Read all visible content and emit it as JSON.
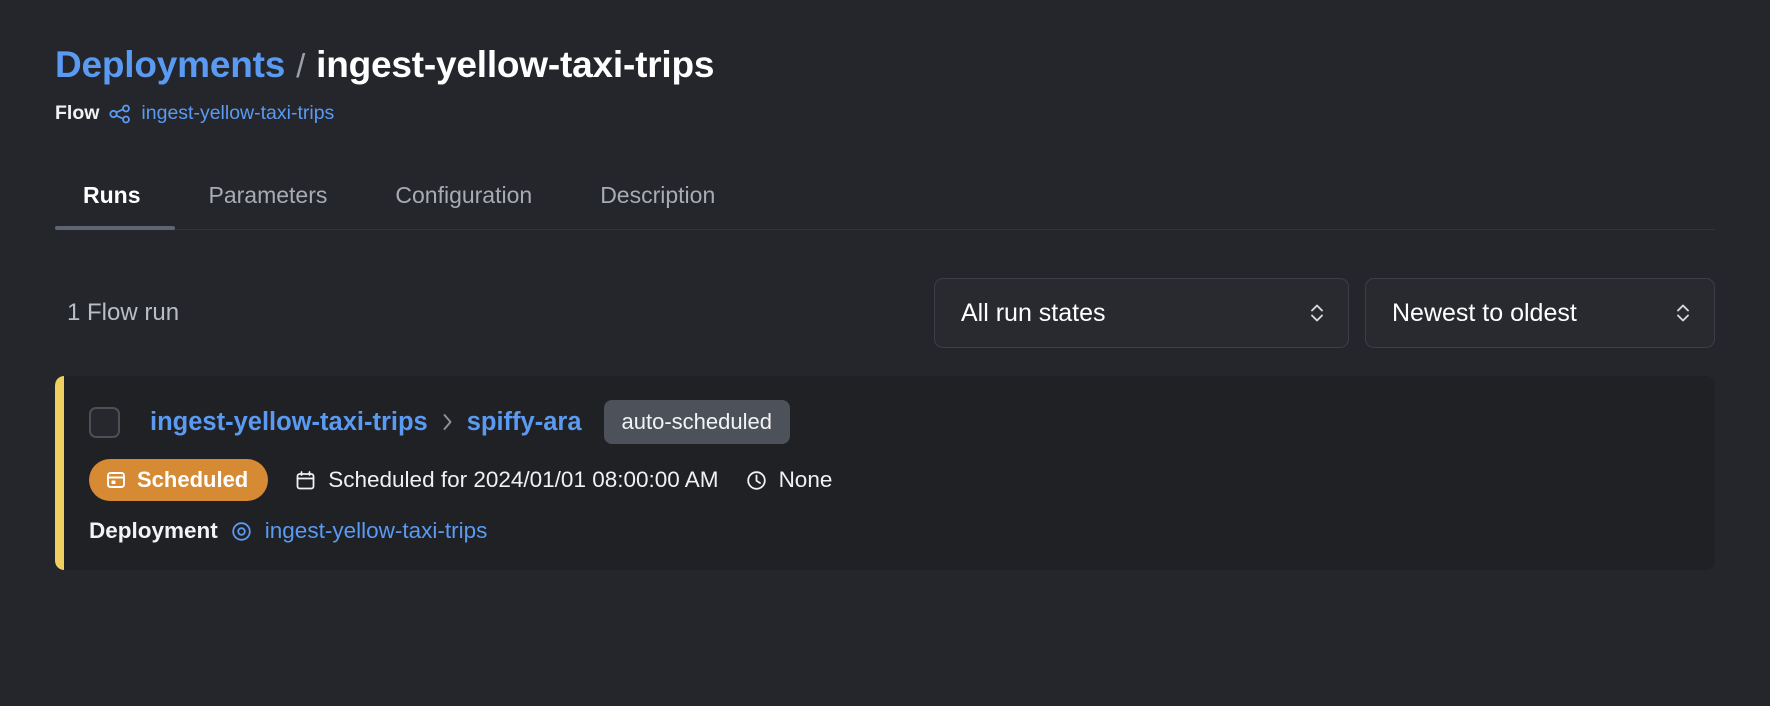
{
  "breadcrumb": {
    "parent": "Deployments",
    "separator": "/",
    "current": "ingest-yellow-taxi-trips"
  },
  "flow": {
    "label": "Flow",
    "icon": "flow-graph-icon",
    "name": "ingest-yellow-taxi-trips"
  },
  "tabs": [
    {
      "label": "Runs",
      "active": true
    },
    {
      "label": "Parameters",
      "active": false
    },
    {
      "label": "Configuration",
      "active": false
    },
    {
      "label": "Description",
      "active": false
    }
  ],
  "filters": {
    "run_count": "1 Flow run",
    "state_filter": "All run states",
    "sort_filter": "Newest to oldest"
  },
  "flow_run": {
    "accent_color": "#f0cf61",
    "flow_name": "ingest-yellow-taxi-trips",
    "chevron": "›",
    "run_name": "spiffy-ara",
    "tag": "auto-scheduled",
    "state": "Scheduled",
    "scheduled_for": "Scheduled for 2024/01/01 08:00:00 AM",
    "duration": "None",
    "deployment_label": "Deployment",
    "deployment_name": "ingest-yellow-taxi-trips"
  },
  "colors": {
    "background": "#24262b",
    "card_background": "#1f2125",
    "link": "#5a9af2",
    "scheduled": "#d68a33",
    "tag": "#4d5159"
  }
}
